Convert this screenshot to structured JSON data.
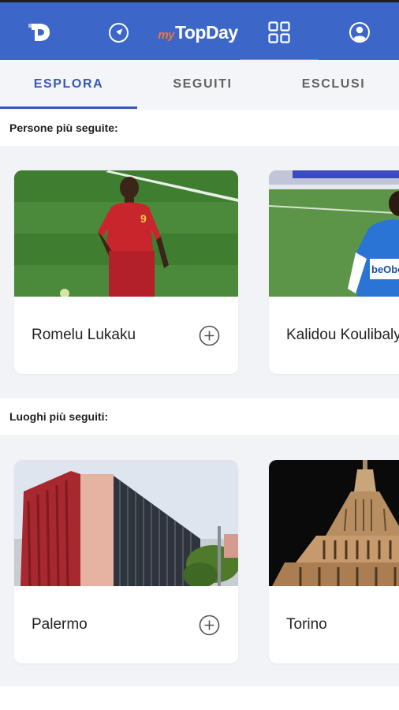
{
  "app": {
    "brand_prefix": "my",
    "brand_name": "TopDay"
  },
  "nav": {
    "logo_icon": "topday-logo-icon",
    "explore_icon": "compass-icon",
    "grid_icon": "grid-icon",
    "profile_icon": "account-circle-icon",
    "active_accent": "#ef7a2f",
    "bar_color": "#3d66c9"
  },
  "tabs": [
    {
      "label": "ESPLORA",
      "active": true
    },
    {
      "label": "SEGUITI",
      "active": false
    },
    {
      "label": "ESCLUSI",
      "active": false
    }
  ],
  "sections": {
    "people": {
      "title": "Persone più seguite:",
      "cards": [
        {
          "name": "Romelu Lukaku",
          "action_icon": "add-circle-icon"
        },
        {
          "name": "Kalidou Koulibaly",
          "action_icon": "add-circle-icon"
        }
      ]
    },
    "places": {
      "title": "Luoghi più seguiti:",
      "cards": [
        {
          "name": "Palermo",
          "action_icon": "add-circle-icon"
        },
        {
          "name": "Torino",
          "action_icon": "add-circle-icon"
        }
      ]
    }
  }
}
